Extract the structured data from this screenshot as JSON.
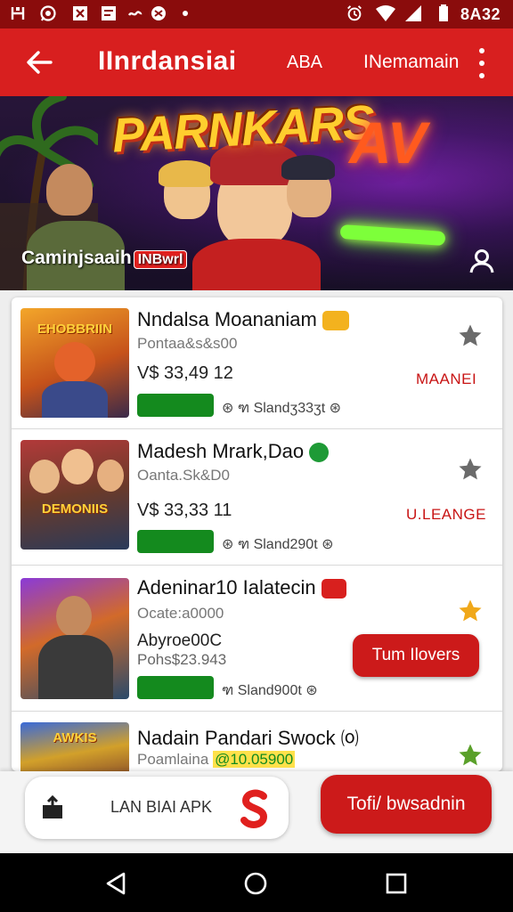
{
  "status_bar": {
    "time": "8A32",
    "icons": [
      "app-h-icon",
      "whatsapp-icon",
      "x-icon",
      "news-icon",
      "wave-icon",
      "camera-icon",
      "dot-icon",
      "alarm-icon",
      "wifi-icon",
      "signal-icon",
      "battery-icon"
    ]
  },
  "app_bar": {
    "title": "IInrdansiai",
    "abbr": "ABA",
    "nav_link": "INemamain"
  },
  "banner": {
    "title": "PARNKARS",
    "neon": "AV",
    "caption": "Caminjsaaih",
    "caption_tag": "INBwrl"
  },
  "items": [
    {
      "title": "Nndalsa Moananiam",
      "subtitle": "Pontaa&s&s00",
      "price": "V$ 33,49 12",
      "meta": "Slandʒ33ʒt",
      "action": "MAANEI",
      "thumb_label": "EHOBBRIIN",
      "badge_color": "#f3b21e",
      "star_color": "#6b6b6b"
    },
    {
      "title": "Madesh Mrark,Dao",
      "subtitle": "Oanta.Sk&D0",
      "price": "V$ 33,33 11",
      "meta": "Sland290t",
      "action": "U.LEANGE",
      "thumb_label": "DEMONIIS",
      "badge_color": "#1e9a36",
      "star_color": "#6b6b6b"
    },
    {
      "title": "Adeninar10 Ialatecin",
      "subtitle": "Ocate:a0000",
      "price": "Abyroe00C",
      "price2": "Pohs$23.943",
      "meta": "Sland900t",
      "action": "",
      "thumb_label": "",
      "badge_color": "#d8201e",
      "star_color": "#f0a81a"
    },
    {
      "title": "Nadain Pandari Swock",
      "subtitle": "Poamlaina",
      "subtitle_highlight": "@10.05900",
      "price": "",
      "meta": "",
      "action": "",
      "thumb_label": "AWKIS",
      "badge_color": "",
      "star_color": "#5aa02a"
    }
  ],
  "cta_pill": "Tum Ilovers",
  "bottom": {
    "apk_text": "LAN BIAI APK",
    "cta": "Tofi/ bwsadnin"
  },
  "colors": {
    "primary": "#d81f1f",
    "status": "#8a0c0c",
    "progress": "#148a1e"
  }
}
